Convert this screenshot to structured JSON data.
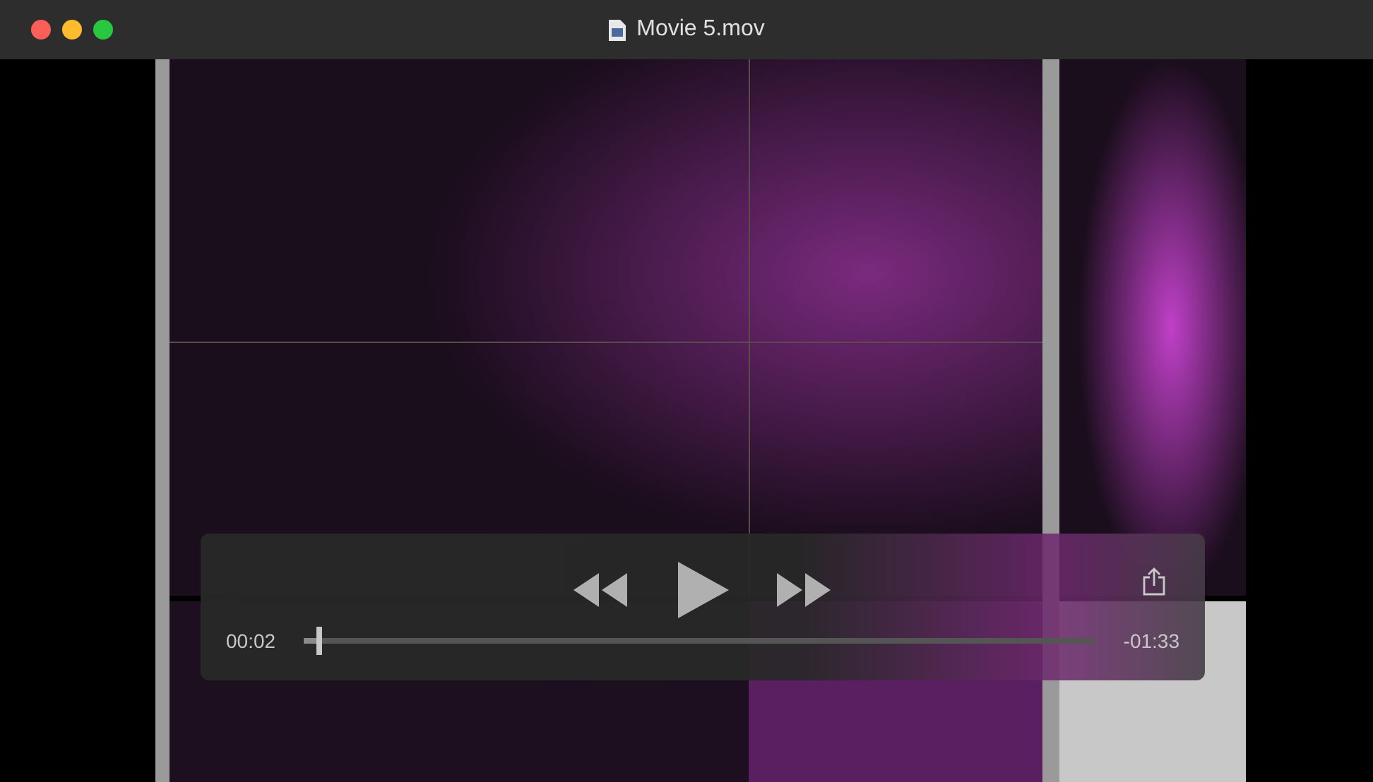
{
  "window": {
    "title": "Movie 5.mov"
  },
  "controls": {
    "elapsed": "00:02",
    "remaining": "-01:33",
    "progress": {
      "level": 0.02
    }
  }
}
